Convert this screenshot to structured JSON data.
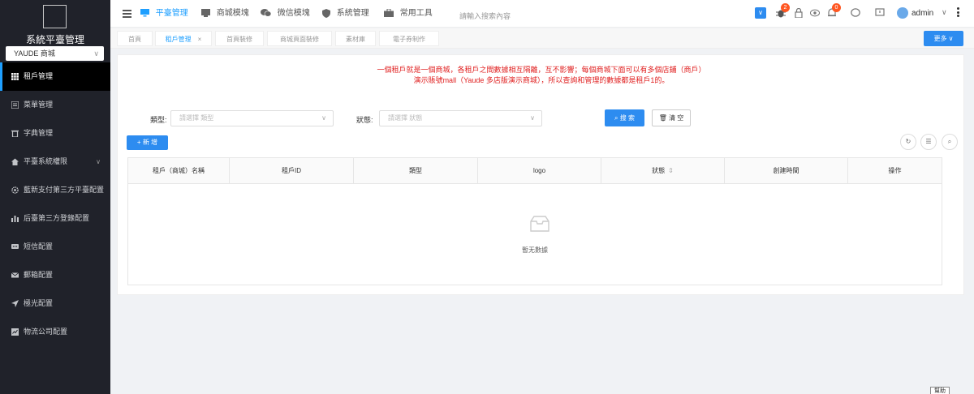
{
  "sidebar": {
    "brand": "系統平臺管理",
    "store_select": "YAUDE 商城",
    "items": [
      {
        "label": "租戶管理",
        "icon": "grid-icon"
      },
      {
        "label": "菜單管理",
        "icon": "menu-book-icon"
      },
      {
        "label": "字典管理",
        "icon": "trash-dictionary-icon"
      },
      {
        "label": "平臺系統權限",
        "icon": "home-icon"
      },
      {
        "label": "藍新支付第三方平臺配置",
        "icon": "gear-icon"
      },
      {
        "label": "后臺第三方登錄配置",
        "icon": "bar-chart-icon"
      },
      {
        "label": "短信配置",
        "icon": "message-icon"
      },
      {
        "label": "郵箱配置",
        "icon": "mail-icon"
      },
      {
        "label": "極光配置",
        "icon": "send-icon"
      },
      {
        "label": "物流公司配置",
        "icon": "chart-box-icon"
      }
    ]
  },
  "header": {
    "tabs": [
      {
        "label": "平臺管理",
        "icon": "monitor-icon"
      },
      {
        "label": "商城模塊",
        "icon": "store-icon"
      },
      {
        "label": "微信模塊",
        "icon": "wechat-icon"
      },
      {
        "label": "系統管理",
        "icon": "shield-icon"
      },
      {
        "label": "常用工具",
        "icon": "toolbox-icon"
      }
    ],
    "search_placeholder": "請輸入搜索內容",
    "bug_badge": "2",
    "bell_badge": "0",
    "user": "admin"
  },
  "page_tabs": {
    "items": [
      "首頁",
      "租戶管理",
      "首頁裝修",
      "商城頁面裝修",
      "素材庫",
      "電子券制作"
    ],
    "more": "更多"
  },
  "main": {
    "notice_line1": "一個租戶就是一個商城，各租戶之間數據相互隔離，互不影響；每個商城下面可以有多個店鋪（商戶）",
    "notice_line2": "演示賬號mall（Yaude 多店版演示商城），所以查詢和管理的數據都是租戶1的。",
    "filter_type_label": "類型:",
    "filter_type_placeholder": "請選擇 類型",
    "filter_status_label": "狀態:",
    "filter_status_placeholder": "請選擇 狀態",
    "search_button": "搜 索",
    "clear_button": "清 空",
    "add_button": "新 增",
    "columns": [
      "租戶（商城）名稱",
      "租戶ID",
      "類型",
      "logo",
      "狀態",
      "創建時間",
      "操作"
    ],
    "empty_text": "暫无數據"
  },
  "help_label": "幫助",
  "colors": {
    "accent": "#2d8cf0",
    "sidebar": "#20222a",
    "notice": "#e02020"
  }
}
